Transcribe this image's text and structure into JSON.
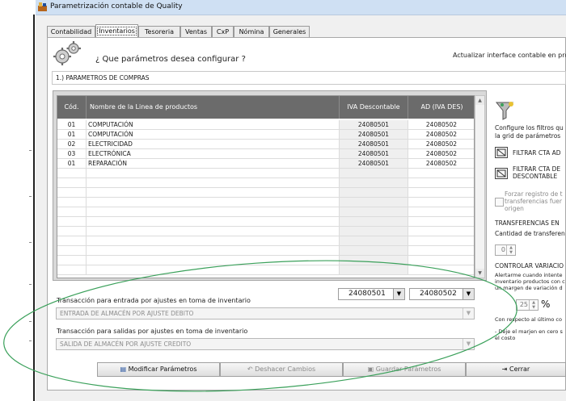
{
  "window": {
    "title": "Parametrización contable de Quality"
  },
  "tabs": [
    {
      "label": "Contabilidad"
    },
    {
      "label": "Inventarios"
    },
    {
      "label": "Tesoreria"
    },
    {
      "label": "Ventas"
    },
    {
      "label": "CxP"
    },
    {
      "label": "Nómina"
    },
    {
      "label": "Generales"
    }
  ],
  "header": {
    "question": "¿ Que parámetros desea configurar ?",
    "right_text": "Actualizar interface contable en pro"
  },
  "section": {
    "label": "1.) PARAMETROS DE COMPRAS"
  },
  "grid": {
    "columns": [
      "Cód.",
      "Nombre de la Linea de productos",
      "IVA Descontable",
      "AD (IVA DES)"
    ],
    "rows": [
      [
        "01",
        "COMPUTACIÓN",
        "24080501",
        "24080502"
      ],
      [
        "01",
        "COMPUTACIÓN",
        "24080501",
        "24080502"
      ],
      [
        "02",
        "ELECTRICIDAD",
        "24080501",
        "24080502"
      ],
      [
        "03",
        "ELECTRÓNICA",
        "24080501",
        "24080502"
      ],
      [
        "01",
        "REPARACIÓN",
        "24080501",
        "24080502"
      ]
    ]
  },
  "combos": {
    "iva": "24080501",
    "ad": "24080502"
  },
  "entrada": {
    "label": "Transacción para entrada por ajustes en toma de inventario",
    "value": "ENTRADA DE ALMACÉN POR AJUSTE DEBITO"
  },
  "salida": {
    "label": "Transacción para salidas por ajustes en toma de inventario",
    "value": "SALIDA DE ALMACÉN POR AJUSTE CREDITO"
  },
  "right_panel": {
    "filter_line1": "Configure los filtros qu",
    "filter_line2": "la grid de parámetros",
    "btn1": "FILTRAR CTA AD",
    "btn2_line1": "FILTRAR CTA DE",
    "btn2_line2": "DESCONTABLE",
    "force_line1": "Forzar registro de t",
    "force_line2": "transferencias fuer",
    "force_line3": "origen",
    "transfer_title": "TRANSFERENCIAS EN",
    "transfer_qty": "Cantidad de transferen",
    "transfer_value": "0",
    "control_title": "CONTROLAR VARIACIO",
    "control_line1": "Alertarme cuando intente",
    "control_line2": "inventario productos con c",
    "control_line3": "un margen de variación d",
    "percent_value": "25",
    "percent_sign": "%",
    "respect_text": "Con  respecto al último co",
    "margin_line1": "- Deje el marjen en cero s",
    "margin_line2": "el costo"
  },
  "buttons": {
    "modify": "Modificar Parámetros",
    "undo": "Deshacer Cambios",
    "save": "Guardar Parámetros",
    "close": "Cerrar"
  },
  "colors": {
    "grid_header": "#6b6b6b",
    "accent_curve": "#3aa05a",
    "title_bar": "#cfe0f3"
  }
}
